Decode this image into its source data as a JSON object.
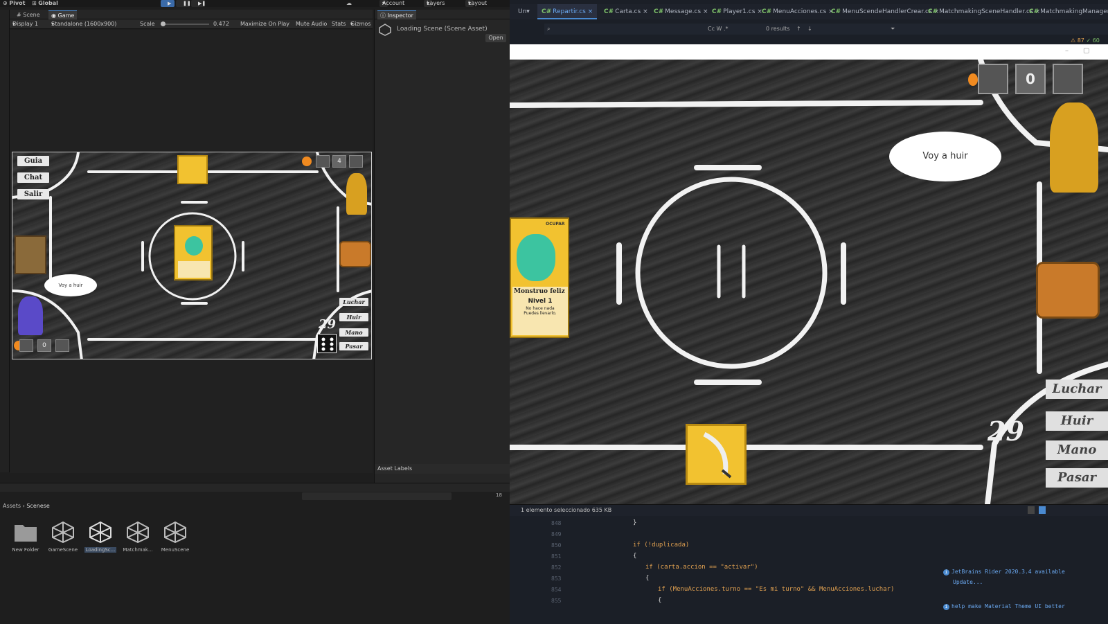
{
  "unity": {
    "topbar": {
      "pivot": "Pivot",
      "global": "Global",
      "account": "Account",
      "layers": "Layers",
      "layout": "Layout"
    },
    "tabs": {
      "scene": "Scene",
      "game": "Game",
      "inspector": "Inspector"
    },
    "game_toolbar": {
      "display": "Display 1",
      "resolution": "Standalone (1600x900)",
      "scale_label": "Scale",
      "scale_value": "0.472",
      "maximize": "Maximize On Play",
      "mute": "Mute Audio",
      "stats": "Stats",
      "gizmos": "Gizmos"
    },
    "inspector": {
      "asset_title": "Loading Scene (Scene Asset)",
      "open_button": "Open",
      "asset_labels": "Asset Labels"
    },
    "project": {
      "breadcrumb_root": "Assets",
      "breadcrumb_child": "Scenese",
      "count": "18",
      "assets": [
        {
          "name": "New Folder",
          "kind": "folder"
        },
        {
          "name": "GameScene",
          "kind": "unity-scene"
        },
        {
          "name": "LoadingSc...",
          "kind": "unity-scene"
        },
        {
          "name": "Matchmak...",
          "kind": "unity-scene"
        },
        {
          "name": "MenuScene",
          "kind": "unity-scene"
        }
      ]
    },
    "game": {
      "menu": {
        "guia": "Guia",
        "chat": "Chat",
        "salir": "Salir"
      },
      "bubble": "Voy a huir",
      "actions": {
        "luchar": "Luchar",
        "huir": "Huir",
        "mano": "Mano",
        "pasar": "Pasar"
      },
      "counter": "29",
      "top_counter": "4",
      "bottom_counter": "0"
    }
  },
  "ide": {
    "project_tab": "Un",
    "tabs": [
      {
        "label": "Repartir.cs",
        "active": true
      },
      {
        "label": "Carta.cs",
        "active": false
      },
      {
        "label": "Message.cs",
        "active": false
      },
      {
        "label": "Player1.cs",
        "active": false
      },
      {
        "label": "MenuAcciones.cs",
        "active": false
      },
      {
        "label": "MenuScendeHandlerCrear.cs",
        "active": false
      },
      {
        "label": "MatchmakingSceneHandler.cs",
        "active": false
      },
      {
        "label": "MatchmakingManager.cs",
        "active": false
      }
    ],
    "find_results": "0 results",
    "warnings": "87",
    "checks": "60",
    "status": "1 elemento seleccionado  635 KB",
    "code_lines": [
      {
        "num": "848",
        "text": "}"
      },
      {
        "num": "849",
        "text": ""
      },
      {
        "num": "850",
        "text": "if (!duplicada)"
      },
      {
        "num": "851",
        "text": "{"
      },
      {
        "num": "852",
        "text": "if (carta.accion == \"activar\")"
      },
      {
        "num": "853",
        "text": "{"
      },
      {
        "num": "854",
        "text": "if (MenuAcciones.turno == \"Es mi turno\" && MenuAcciones.luchar)"
      },
      {
        "num": "855",
        "text": "{"
      }
    ],
    "notifications": [
      {
        "title": "JetBrains Rider 2020.3.4 available",
        "action": "Update..."
      },
      {
        "title": "help make Material Theme UI better",
        "action": ""
      }
    ]
  },
  "game_big": {
    "bubble": "Voy a huir",
    "card_name": "Monstruo feliz",
    "card_level": "Nivel 1",
    "card_desc": "No hace nada",
    "card_desc2": "Puedes llevarlo.",
    "card_tag": "OCUPAR",
    "counter": "29",
    "top_counter": "0",
    "actions": {
      "luchar": "Luchar",
      "huir": "Huir",
      "mano": "Mano",
      "pasar": "Pasar"
    }
  },
  "colors": {
    "accent": "#4a8ad0",
    "card_yellow": "#f2c230",
    "board_dark": "#2f2f2f",
    "keyword": "#e0a050"
  }
}
